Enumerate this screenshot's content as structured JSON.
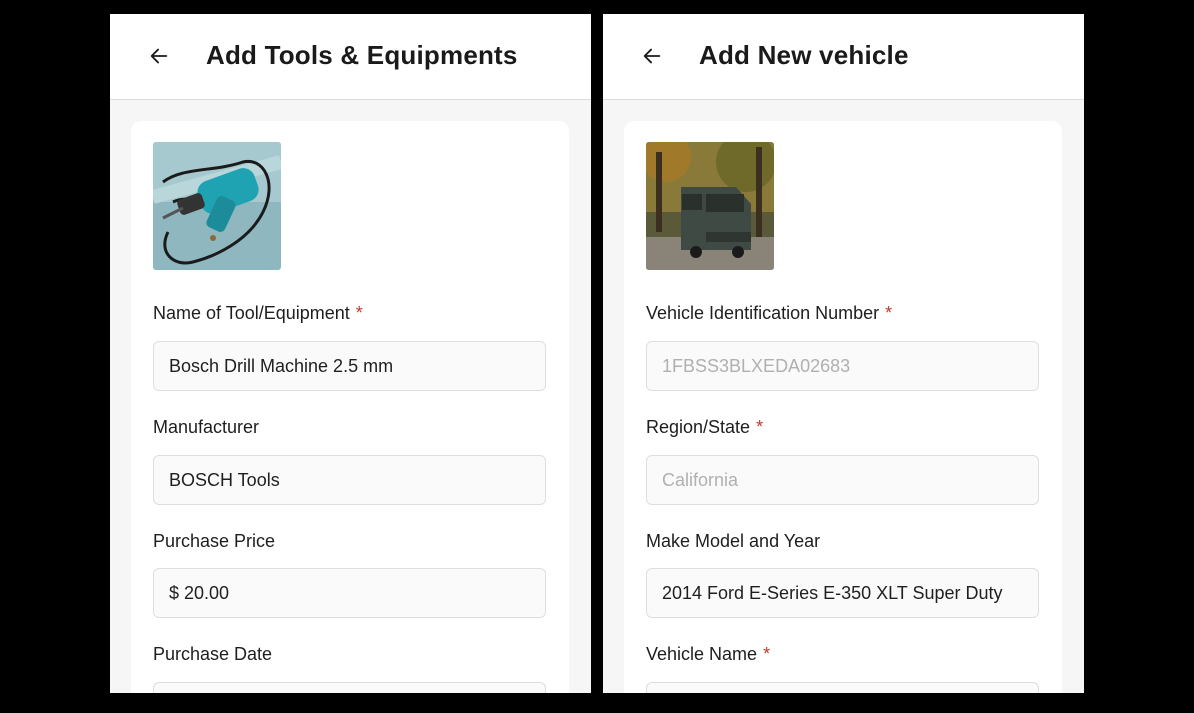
{
  "tools_panel": {
    "title": "Add Tools & Equipments",
    "image_icon": "drill-photo",
    "fields": [
      {
        "label": "Name of Tool/Equipment",
        "required": "*",
        "value": "Bosch Drill Machine 2.5 mm"
      },
      {
        "label": "Manufacturer",
        "value": "BOSCH Tools"
      },
      {
        "label": "Purchase Price",
        "value": "$ 20.00"
      },
      {
        "label": "Purchase Date",
        "value": ""
      }
    ]
  },
  "vehicle_panel": {
    "title": "Add New vehicle",
    "image_icon": "van-photo",
    "fields": [
      {
        "label": "Vehicle Identification Number",
        "required": "*",
        "placeholder": "1FBSS3BLXEDA02683"
      },
      {
        "label": "Region/State",
        "required": "*",
        "placeholder": "California"
      },
      {
        "label": "Make Model and Year",
        "value": "2014 Ford E-Series E-350 XLT Super Duty"
      },
      {
        "label": "Vehicle Name",
        "required": "*",
        "value": ""
      }
    ]
  },
  "colors": {
    "required": "#c0392b",
    "placeholder": "#b0b0b0",
    "background": "#000000"
  },
  "icons": {
    "back": "arrow-left-icon"
  }
}
